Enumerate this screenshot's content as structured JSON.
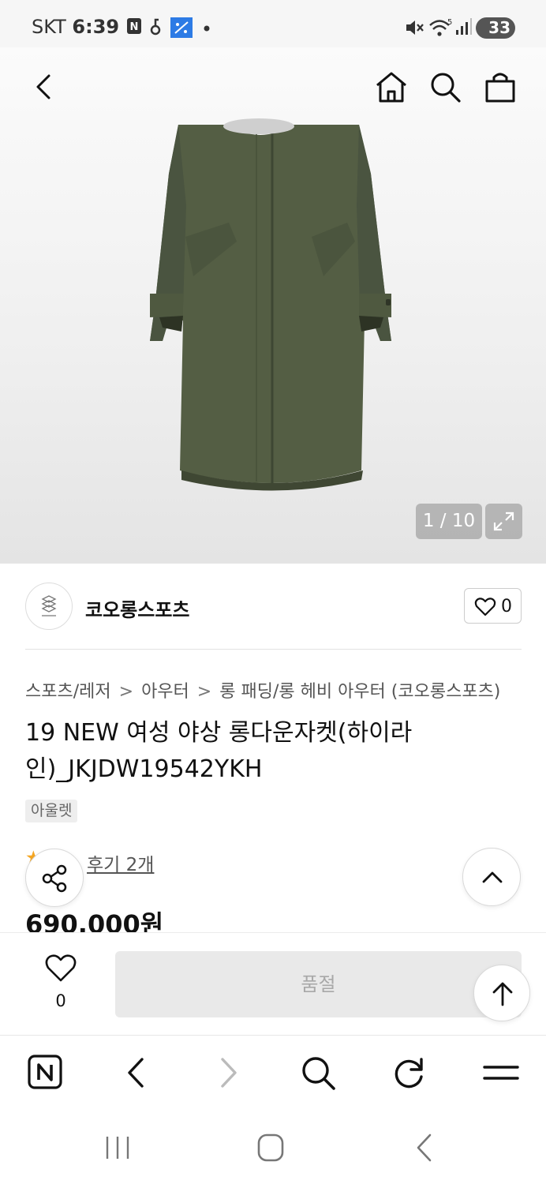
{
  "status_bar": {
    "carrier": "SKT",
    "time": "6:39",
    "battery": "33"
  },
  "product_gallery": {
    "counter": "1 / 10"
  },
  "seller": {
    "name": "코오롱스포츠",
    "like_count": "0"
  },
  "breadcrumb": {
    "items": [
      "스포츠/레저",
      "아우터",
      "롱 패딩/롱 헤비 아우터 (코오롱스포츠)"
    ]
  },
  "product": {
    "title": "19 NEW 여성 야상 롱다운자켓(하이라인)_JKJDW19542YKH",
    "tag": "아울렛",
    "rating": "5",
    "review_link": "후기 2개",
    "price": "690,000원"
  },
  "buy_bar": {
    "wish_count": "0",
    "soldout_label": "품절"
  },
  "colors": {
    "jacket": "#4f5a3f",
    "counter_bg": "#8c8c8c",
    "soldout_bg": "#e9e9e9",
    "star": "#f5a623"
  }
}
